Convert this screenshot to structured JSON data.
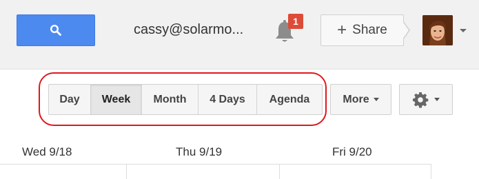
{
  "header": {
    "account_email": "cassy@solarmo...",
    "notification_count": "1",
    "share_label": "Share",
    "share_plus": "+"
  },
  "view_switcher": {
    "buttons": [
      {
        "label": "Day",
        "active": false
      },
      {
        "label": "Week",
        "active": true
      },
      {
        "label": "Month",
        "active": false
      },
      {
        "label": "4 Days",
        "active": false
      },
      {
        "label": "Agenda",
        "active": false
      }
    ],
    "more_label": "More"
  },
  "days": [
    "Wed 9/18",
    "Thu 9/19",
    "Fri 9/20"
  ],
  "colors": {
    "search_blue": "#4d8af0",
    "badge_red": "#dd4b39",
    "highlight_red": "#e1161b"
  },
  "icons": {
    "search": "search-icon",
    "bell": "bell-icon",
    "gear": "gear-icon",
    "caret": "chevron-down-icon"
  }
}
